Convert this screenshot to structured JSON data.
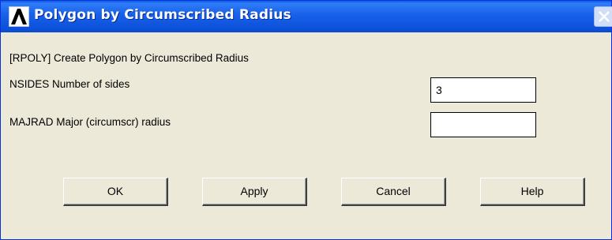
{
  "window": {
    "title": "Polygon by Circumscribed Radius",
    "icon": "ansys-logo-icon",
    "close_icon": "close-icon"
  },
  "dialog": {
    "command_line": "[RPOLY]  Create Polygon by Circumscribed Radius",
    "fields": [
      {
        "label": "NSIDES  Number of sides",
        "value": "3",
        "placeholder": ""
      },
      {
        "label": "MAJRAD  Major (circumscr) radius",
        "value": "",
        "placeholder": ""
      }
    ]
  },
  "buttons": {
    "ok": "OK",
    "apply": "Apply",
    "cancel": "Cancel",
    "help": "Help"
  },
  "colors": {
    "titlebar": "#1760ea",
    "dialog_bg": "#ece9d8",
    "title_text": "#ffffff"
  }
}
